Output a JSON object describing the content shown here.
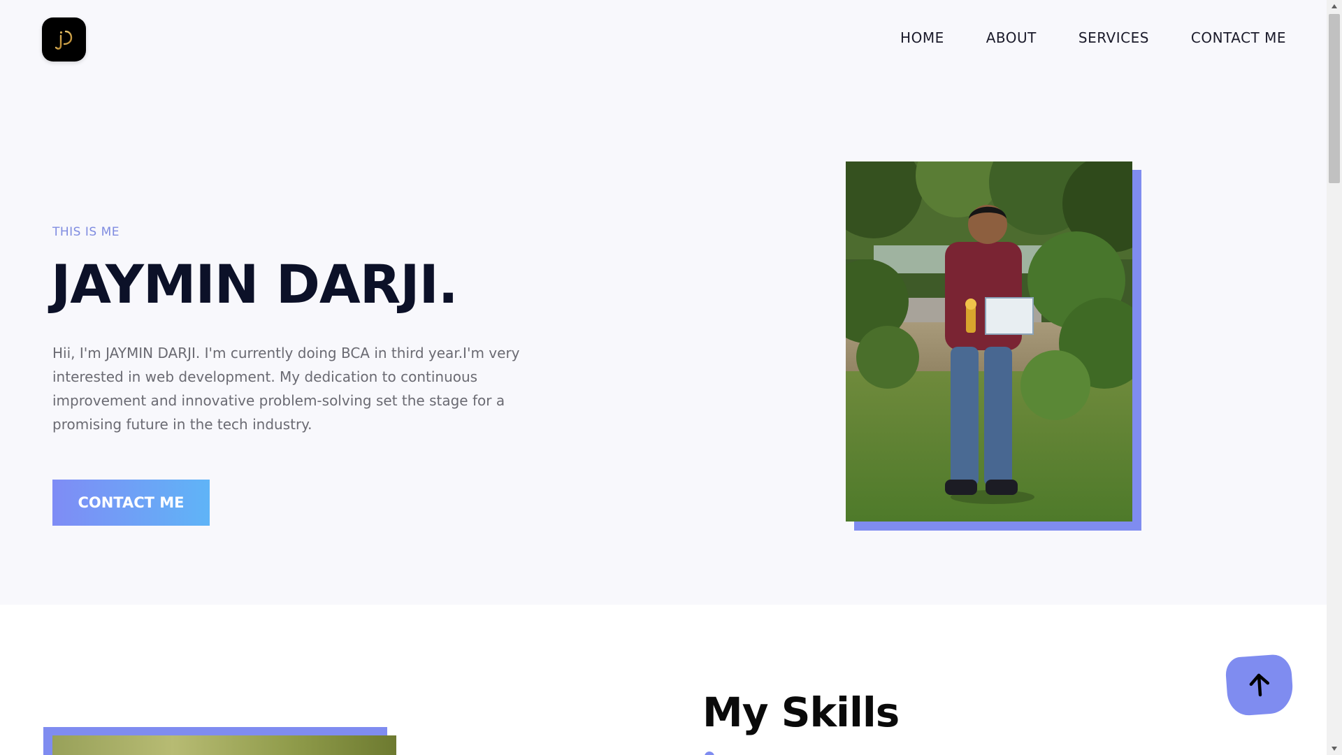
{
  "header": {
    "logo_icon": "jd-monogram-logo",
    "nav": [
      {
        "label": "HOME"
      },
      {
        "label": "ABOUT"
      },
      {
        "label": "SERVICES"
      },
      {
        "label": "CONTACT ME"
      }
    ]
  },
  "hero": {
    "kicker": "THIS IS ME",
    "title": "JAYMIN DARJI.",
    "description": "Hii, I'm JAYMIN DARJI. I'm currently doing BCA in third year.I'm very interested in web development. My dedication to continuous improvement and innovative problem-solving set the stage for a promising future in the tech industry.",
    "cta_label": "CONTACT ME",
    "photo_icon": "profile-photo"
  },
  "skills": {
    "title": "My Skills"
  },
  "scroll_top": {
    "icon": "arrow-up-icon"
  },
  "colors": {
    "accent": "#7f8cf0",
    "gradient_start": "#7f8cf5",
    "gradient_end": "#5fb4f7",
    "title": "#0c1128",
    "hero_bg": "#f8f8fc"
  }
}
